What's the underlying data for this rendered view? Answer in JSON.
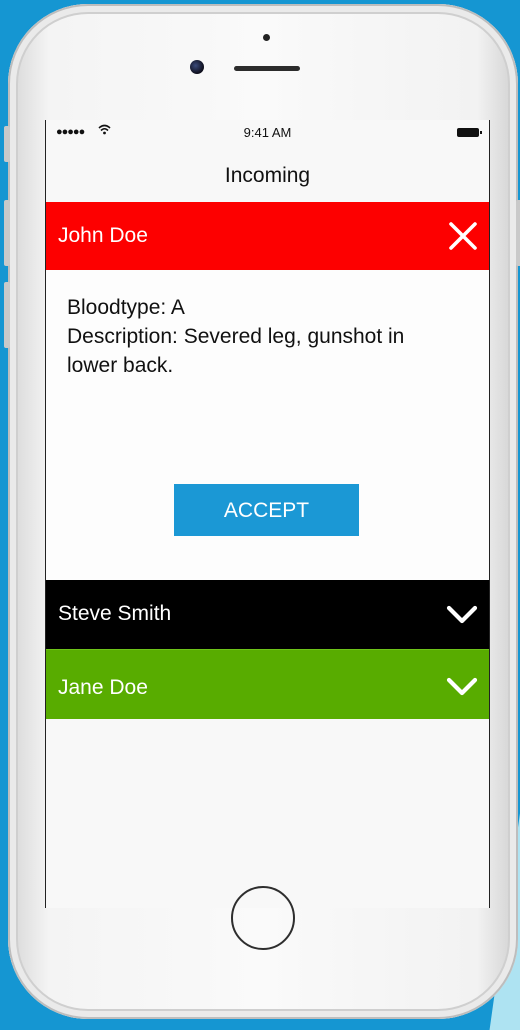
{
  "status_bar": {
    "signal": "●●●●●",
    "time": "9:41 AM"
  },
  "nav": {
    "title": "Incoming"
  },
  "patients": [
    {
      "name": "John Doe",
      "color": "#fd0000",
      "expanded": true,
      "control_icon": "close-icon"
    },
    {
      "name": "Steve Smith",
      "color": "#000000",
      "expanded": false,
      "control_icon": "chevron-down-icon"
    },
    {
      "name": "Jane Doe",
      "color": "#58ac00",
      "expanded": false,
      "control_icon": "chevron-down-icon"
    }
  ],
  "details": {
    "bloodtype": "Bloodtype: A",
    "description": "Description: Severed leg, gunshot in lower back.",
    "accept_label": "ACCEPT"
  }
}
